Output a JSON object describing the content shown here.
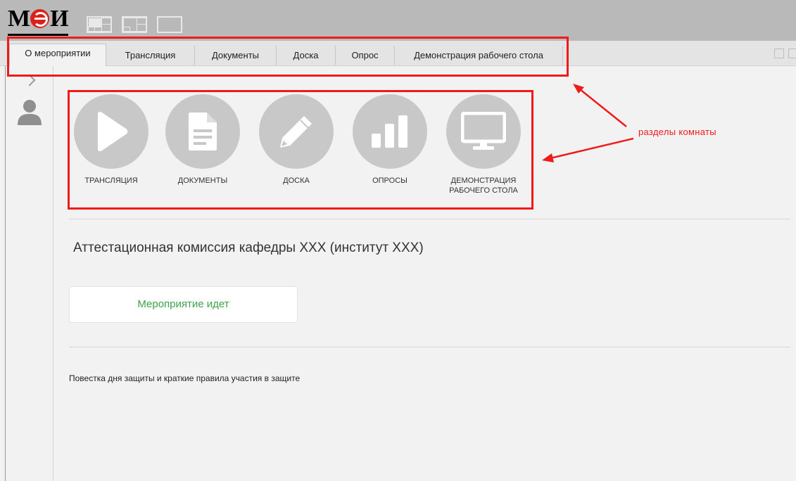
{
  "header": {
    "logo_text_left": "М",
    "logo_text_right": "И"
  },
  "tabs": [
    {
      "label": "О мероприятии",
      "active": true
    },
    {
      "label": "Трансляция",
      "active": false
    },
    {
      "label": "Документы",
      "active": false
    },
    {
      "label": "Доска",
      "active": false
    },
    {
      "label": "Опрос",
      "active": false
    },
    {
      "label": "Демонстрация рабочего стола",
      "active": false
    }
  ],
  "sections": [
    {
      "label": "ТРАНСЛЯЦИЯ",
      "icon": "play-icon"
    },
    {
      "label": "ДОКУМЕНТЫ",
      "icon": "document-icon"
    },
    {
      "label": "ДОСКА",
      "icon": "pencil-icon"
    },
    {
      "label": "ОПРОСЫ",
      "icon": "bar-chart-icon"
    },
    {
      "label": "ДЕМОНСТРАЦИЯ\nРАБОЧЕГО СТОЛА",
      "icon": "monitor-icon"
    }
  ],
  "room": {
    "title": "Аттестационная комиссия кафедры XXX (институт XXX)",
    "status": "Мероприятие идет",
    "agenda": "Повестка дня защиты и краткие правила участия в защите"
  },
  "annotation": {
    "text": "разделы комнаты"
  },
  "colors": {
    "header_bg": "#b9b9b9",
    "content_bg": "#f2f2f2",
    "icon_circle": "#c8c8c8",
    "status_green": "#3ea34a",
    "annotation_red": "#ef1b1b"
  }
}
